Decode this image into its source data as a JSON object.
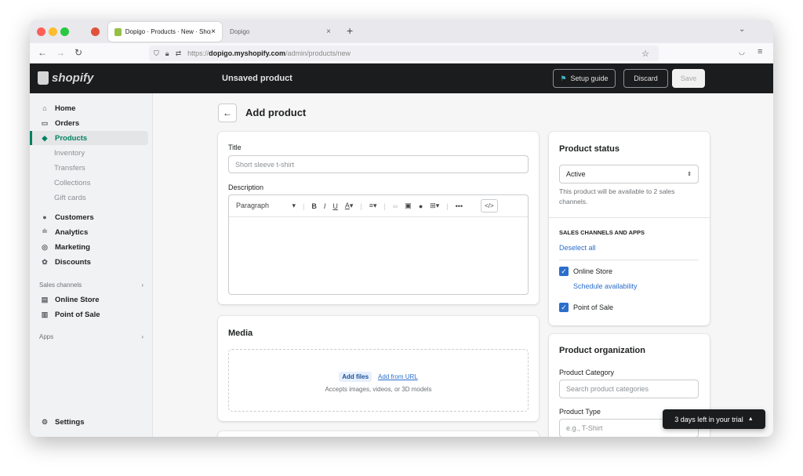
{
  "browser": {
    "tabs": [
      {
        "label": "Dopigo · Products · New · Shop"
      },
      {
        "label": "Dopigo"
      }
    ],
    "url_prefix": "https://",
    "url_host": "dopigo.myshopify.com",
    "url_path": "/admin/products/new",
    "new_tab": "+",
    "close": "×"
  },
  "header": {
    "logo": "shopify",
    "title": "Unsaved product",
    "setup_guide": "Setup guide",
    "discard": "Discard",
    "save": "Save"
  },
  "sidebar": {
    "items": [
      {
        "label": "Home",
        "icon": "⌂"
      },
      {
        "label": "Orders",
        "icon": "▭"
      },
      {
        "label": "Products",
        "icon": "◆"
      }
    ],
    "sub_items": [
      "Inventory",
      "Transfers",
      "Collections",
      "Gift cards"
    ],
    "items2": [
      {
        "label": "Customers",
        "icon": "●"
      },
      {
        "label": "Analytics",
        "icon": "ılı"
      },
      {
        "label": "Marketing",
        "icon": "◎"
      },
      {
        "label": "Discounts",
        "icon": "✿"
      }
    ],
    "sales_channels": "Sales channels",
    "channels": [
      {
        "label": "Online Store",
        "icon": "▤"
      },
      {
        "label": "Point of Sale",
        "icon": "▥"
      }
    ],
    "apps": "Apps",
    "settings": "Settings"
  },
  "page": {
    "title": "Add product",
    "back": "←"
  },
  "details": {
    "title_label": "Title",
    "title_placeholder": "Short sleeve t-shirt",
    "description_label": "Description",
    "paragraph": "Paragraph"
  },
  "media": {
    "title": "Media",
    "add_files": "Add files",
    "add_url": "Add from URL",
    "hint": "Accepts images, videos, or 3D models"
  },
  "status": {
    "title": "Product status",
    "value": "Active",
    "help": "This product will be available to 2 sales channels.",
    "channels_heading": "SALES CHANNELS AND APPS",
    "deselect": "Deselect all",
    "online_store": "Online Store",
    "schedule": "Schedule availability",
    "pos": "Point of Sale"
  },
  "organization": {
    "title": "Product organization",
    "category_label": "Product Category",
    "category_placeholder": "Search product categories",
    "type_label": "Product Type",
    "type_placeholder": "e.g., T-Shirt"
  },
  "trial": {
    "label": "3 days left in your trial"
  },
  "colors": {
    "accent": "#2c6ecb",
    "products_green": "#008060",
    "header": "#1a1c1d"
  }
}
